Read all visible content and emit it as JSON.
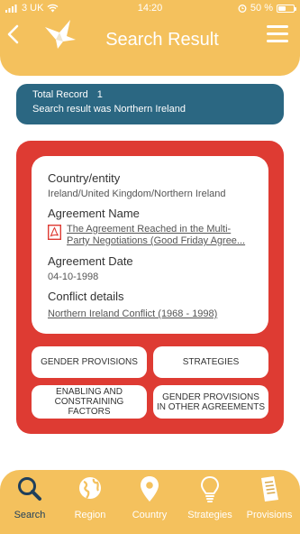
{
  "status_bar": {
    "carrier": "3 UK",
    "time": "14:20",
    "battery": "50 %",
    "battery_level": 0.5
  },
  "header": {
    "title": "Search Result"
  },
  "record": {
    "label": "Total Record",
    "count": "1",
    "message": "Search result was Northern Ireland"
  },
  "result": {
    "country_label": "Country/entity",
    "country_value": "Ireland/United Kingdom/Northern Ireland",
    "agreement_label": "Agreement Name",
    "agreement_value": "The Agreement Reached in the Multi-Party Negotiations (Good Friday Agree...",
    "date_label": "Agreement Date",
    "date_value": "04-10-1998",
    "conflict_label": "Conflict details",
    "conflict_value": "Northern Ireland Conflict (1968 - 1998) "
  },
  "buttons": {
    "gender_provisions": "GENDER PROVISIONS",
    "strategies": "STRATEGIES",
    "enabling": "ENABLING AND CONSTRAINING FACTORS",
    "gender_other": "GENDER PROVISIONS IN OTHER AGREEMENTS"
  },
  "nav": [
    {
      "label": "Search",
      "icon": "search-icon",
      "active": true
    },
    {
      "label": "Region",
      "icon": "globe-icon",
      "active": false
    },
    {
      "label": "Country",
      "icon": "map-pin-icon",
      "active": false
    },
    {
      "label": "Strategies",
      "icon": "lightbulb-icon",
      "active": false
    },
    {
      "label": "Provisions",
      "icon": "document-icon",
      "active": false
    }
  ],
  "colors": {
    "header": "#f4c15d",
    "record_box": "#2b6782",
    "card": "#de3b33",
    "active_nav": "#1f3f5b"
  }
}
